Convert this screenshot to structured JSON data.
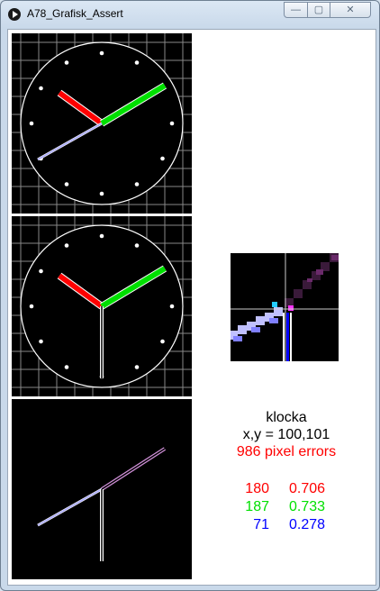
{
  "window": {
    "title": "A78_Grafisk_Assert",
    "controls": {
      "minimize": "—",
      "maximize": "▢",
      "close": "✕"
    }
  },
  "info": {
    "name": "klocka",
    "coords": "x,y = 100,101",
    "errors": "986 pixel errors"
  },
  "stats": [
    {
      "count": "180",
      "ratio": "0.706",
      "color": "#ff0000"
    },
    {
      "count": "187",
      "ratio": "0.733",
      "color": "#00e000"
    },
    {
      "count": "71",
      "ratio": "0.278",
      "color": "#0000ff"
    }
  ]
}
